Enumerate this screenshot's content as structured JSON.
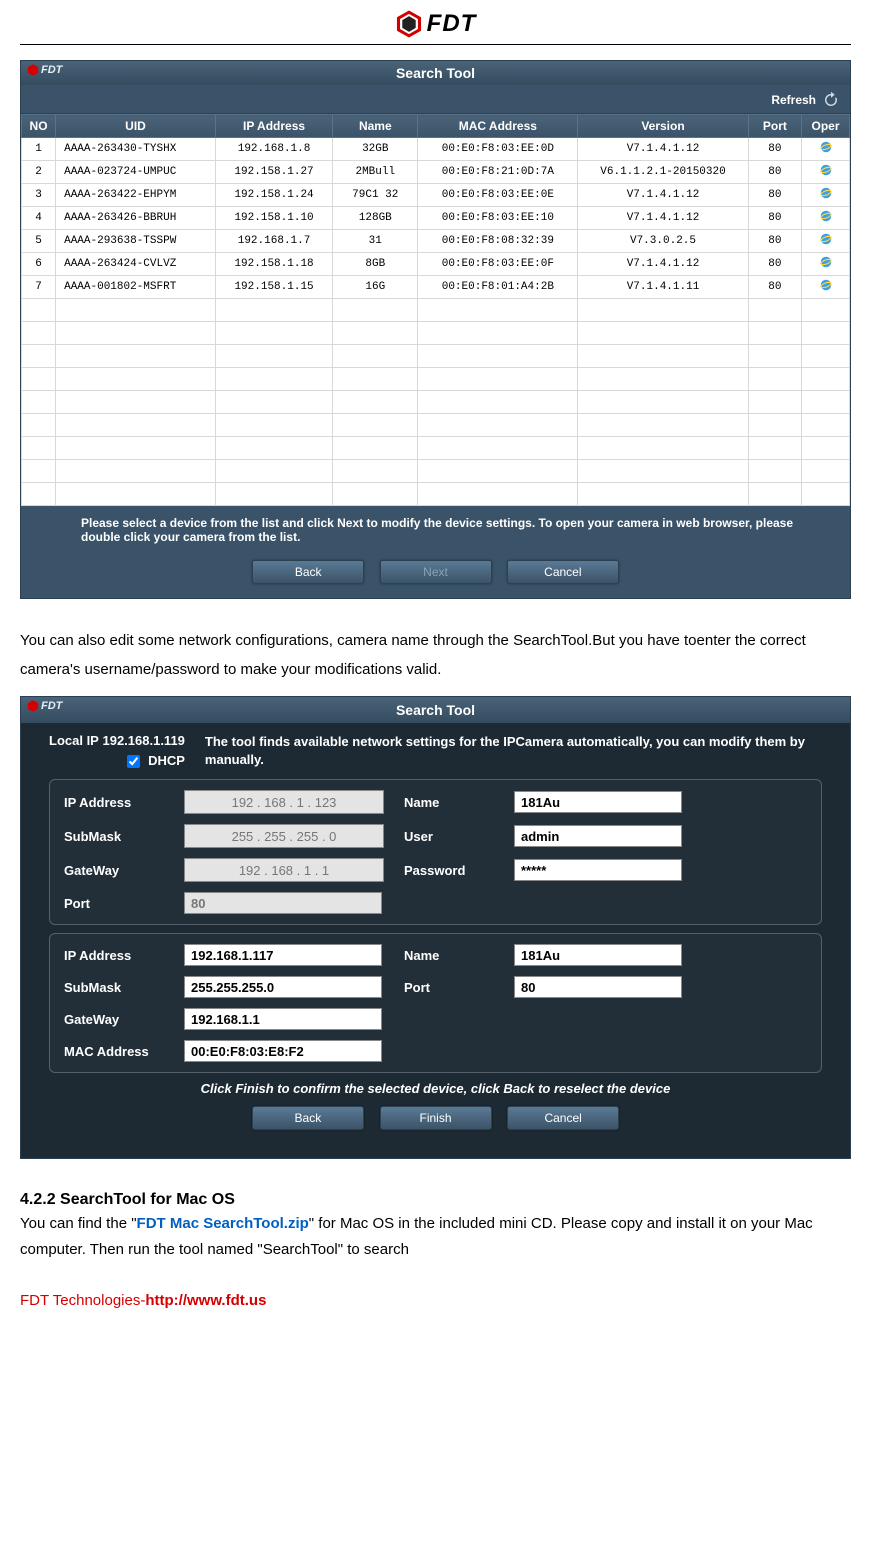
{
  "brand": "FDT",
  "window1": {
    "title": "Search Tool",
    "brand": "FDT",
    "refresh": "Refresh",
    "columns": [
      "NO",
      "UID",
      "IP Address",
      "Name",
      "MAC Address",
      "Version",
      "Port",
      "Oper"
    ],
    "rows": [
      {
        "no": "1",
        "uid": "AAAA-263430-TYSHX",
        "ip": "192.168.1.8",
        "name": "32GB",
        "mac": "00:E0:F8:03:EE:0D",
        "version": "V7.1.4.1.12",
        "port": "80"
      },
      {
        "no": "2",
        "uid": "AAAA-023724-UMPUC",
        "ip": "192.158.1.27",
        "name": "2MBull",
        "mac": "00:E0:F8:21:0D:7A",
        "version": "V6.1.1.2.1-20150320",
        "port": "80"
      },
      {
        "no": "3",
        "uid": "AAAA-263422-EHPYM",
        "ip": "192.158.1.24",
        "name": "79C1 32",
        "mac": "00:E0:F8:03:EE:0E",
        "version": "V7.1.4.1.12",
        "port": "80"
      },
      {
        "no": "4",
        "uid": "AAAA-263426-BBRUH",
        "ip": "192.158.1.10",
        "name": "128GB",
        "mac": "00:E0:F8:03:EE:10",
        "version": "V7.1.4.1.12",
        "port": "80"
      },
      {
        "no": "5",
        "uid": "AAAA-293638-TSSPW",
        "ip": "192.168.1.7",
        "name": "31",
        "mac": "00:E0:F8:08:32:39",
        "version": "V7.3.0.2.5",
        "port": "80"
      },
      {
        "no": "6",
        "uid": "AAAA-263424-CVLVZ",
        "ip": "192.158.1.18",
        "name": "8GB",
        "mac": "00:E0:F8:03:EE:0F",
        "version": "V7.1.4.1.12",
        "port": "80"
      },
      {
        "no": "7",
        "uid": "AAAA-001802-MSFRT",
        "ip": "192.158.1.15",
        "name": "16G",
        "mac": "00:E0:F8:01:A4:2B",
        "version": "V7.1.4.1.11",
        "port": "80"
      }
    ],
    "empty_rows": 9,
    "hint": "Please select a device from the list and click Next to modify the device settings. To open your camera in web browser, please double click your camera from the list.",
    "btn_back": "Back",
    "btn_next": "Next",
    "btn_cancel": "Cancel"
  },
  "para1": "You can also edit some network configurations, camera name through the SearchTool.But you have toenter the correct camera's username/password to make your modifications valid.",
  "window2": {
    "title": "Search Tool",
    "brand": "FDT",
    "local_ip_label": "Local IP",
    "local_ip": "192.168.1.119",
    "dhcp_label": "DHCP",
    "dhcp_checked": true,
    "topmsg": "The tool finds available network settings for the IPCamera automatically, you can modify them by manually.",
    "panel1": {
      "ip_label": "IP Address",
      "ip": "192 . 168 .  1  . 123",
      "sub_label": "SubMask",
      "sub": "255 . 255 . 255 .  0",
      "gw_label": "GateWay",
      "gw": "192 . 168 .  1  .  1",
      "port_label": "Port",
      "port": "80",
      "name_label": "Name",
      "name": "181Au",
      "user_label": "User",
      "user": "admin",
      "pass_label": "Password",
      "pass": "*****"
    },
    "panel2": {
      "ip_label": "IP Address",
      "ip": "192.168.1.117",
      "sub_label": "SubMask",
      "sub": "255.255.255.0",
      "gw_label": "GateWay",
      "gw": "192.168.1.1",
      "mac_label": "MAC Address",
      "mac": "00:E0:F8:03:E8:F2",
      "name_label": "Name",
      "name": "181Au",
      "port_label": "Port",
      "port": "80"
    },
    "confirmmsg": "Click Finish to confirm the selected device, click Back to reselect the device",
    "btn_back": "Back",
    "btn_finish": "Finish",
    "btn_cancel": "Cancel"
  },
  "heading": "4.2.2 SearchTool for Mac OS",
  "para2_a": "You can find the \"",
  "para2_link": "FDT Mac SearchTool.zip",
  "para2_b": "\" for Mac OS in the included mini CD. Please copy and install it on your Mac computer. Then run the tool named \"SearchTool\" to search",
  "footer_a": "FDT Technologies-",
  "footer_b": "http://www.fdt.us"
}
